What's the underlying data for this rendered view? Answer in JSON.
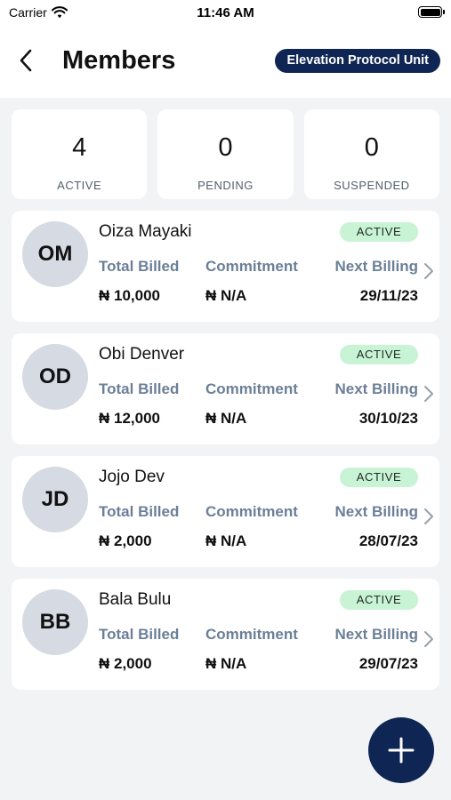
{
  "status_bar": {
    "carrier": "Carrier",
    "time": "11:46 AM"
  },
  "header": {
    "title": "Members",
    "unit_badge": "Elevation Protocol Unit"
  },
  "stats": [
    {
      "value": "4",
      "label": "ACTIVE"
    },
    {
      "value": "0",
      "label": "PENDING"
    },
    {
      "value": "0",
      "label": "SUSPENDED"
    }
  ],
  "column_labels": {
    "billed": "Total Billed",
    "commitment": "Commitment",
    "next": "Next Billing"
  },
  "members": [
    {
      "initials": "OM",
      "name": "Oiza Mayaki",
      "status": "ACTIVE",
      "total_billed": "₦ 10,000",
      "commitment": "₦ N/A",
      "next_billing": "29/11/23"
    },
    {
      "initials": "OD",
      "name": "Obi Denver",
      "status": "ACTIVE",
      "total_billed": "₦ 12,000",
      "commitment": "₦ N/A",
      "next_billing": "30/10/23"
    },
    {
      "initials": "JD",
      "name": "Jojo Dev",
      "status": "ACTIVE",
      "total_billed": "₦ 2,000",
      "commitment": "₦ N/A",
      "next_billing": "28/07/23"
    },
    {
      "initials": "BB",
      "name": "Bala Bulu",
      "status": "ACTIVE",
      "total_billed": "₦ 2,000",
      "commitment": "₦ N/A",
      "next_billing": "29/07/23"
    }
  ],
  "icons": {
    "back": "chevron-left-icon",
    "row_arrow": "chevron-right-icon",
    "fab": "plus-icon",
    "wifi": "wifi-icon",
    "battery": "battery-icon"
  },
  "colors": {
    "navy": "#0f2654",
    "active_badge_bg": "#c8f3d5",
    "label_blue_grey": "#6c7f98",
    "avatar_bg": "#d6dae3"
  }
}
